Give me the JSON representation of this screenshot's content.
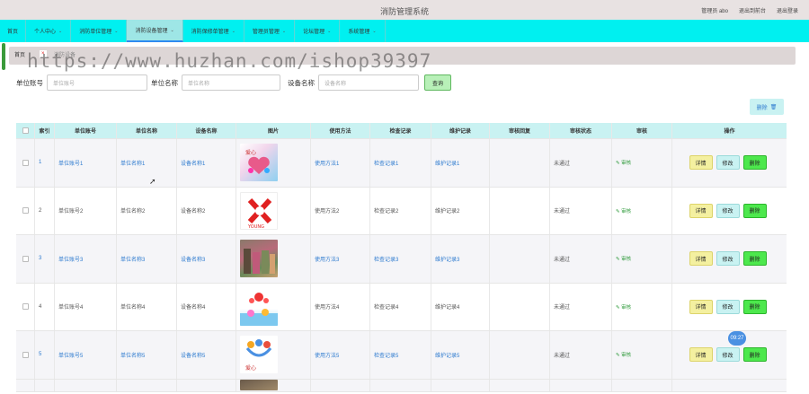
{
  "app": {
    "title": "消防管理系统",
    "admin_label": "管理员 abo",
    "exit_backend": "退出到前台",
    "logout": "退出登录"
  },
  "nav": {
    "items": [
      {
        "label": "首页",
        "caret": false,
        "active": false
      },
      {
        "label": "个人中心",
        "caret": true,
        "active": false
      },
      {
        "label": "消防单位管理",
        "caret": true,
        "active": false
      },
      {
        "label": "消防设备管理",
        "caret": true,
        "active": true
      },
      {
        "label": "消防保修单管理",
        "caret": true,
        "active": false
      },
      {
        "label": "管理员管理",
        "caret": true,
        "active": false
      },
      {
        "label": "论坛管理",
        "caret": true,
        "active": false
      },
      {
        "label": "系统管理",
        "caret": true,
        "active": false
      }
    ]
  },
  "tags": {
    "home": "首页",
    "current": "消防设备",
    "current_tag": "×"
  },
  "watermark": "https://www.huzhan.com/ishop39397",
  "search": {
    "unit_account_label": "单位账号",
    "unit_account_placeholder": "单位账号",
    "unit_name_label": "单位名称",
    "unit_name_placeholder": "单位名称",
    "device_name_label": "设备名称",
    "device_name_placeholder": "设备名称",
    "query_button": "查询"
  },
  "toolbar": {
    "delete_button": "删除"
  },
  "table": {
    "headers": [
      "索引",
      "单位账号",
      "单位名称",
      "设备名称",
      "图片",
      "使用方法",
      "检查记录",
      "维护记录",
      "审核回复",
      "审核状态",
      "审核",
      "操作"
    ],
    "rows": [
      {
        "index": "1",
        "account": "单位账号1",
        "unit": "单位名称1",
        "device": "设备名称1",
        "image": "img1",
        "usage": "使用方法1",
        "check": "检查记录1",
        "maint": "维护记录1",
        "reply": "",
        "status": "未通过",
        "audit": "审核"
      },
      {
        "index": "2",
        "account": "单位账号2",
        "unit": "单位名称2",
        "device": "设备名称2",
        "image": "img2",
        "usage": "使用方法2",
        "check": "检查记录2",
        "maint": "维护记录2",
        "reply": "",
        "status": "未通过",
        "audit": "审核"
      },
      {
        "index": "3",
        "account": "单位账号3",
        "unit": "单位名称3",
        "device": "设备名称3",
        "image": "img3",
        "usage": "使用方法3",
        "check": "检查记录3",
        "maint": "维护记录3",
        "reply": "",
        "status": "未通过",
        "audit": "审核"
      },
      {
        "index": "4",
        "account": "单位账号4",
        "unit": "单位名称4",
        "device": "设备名称4",
        "image": "img4",
        "usage": "使用方法4",
        "check": "检查记录4",
        "maint": "维护记录4",
        "reply": "",
        "status": "未通过",
        "audit": "审核"
      },
      {
        "index": "5",
        "account": "单位账号5",
        "unit": "单位名称5",
        "device": "设备名称5",
        "image": "img5",
        "usage": "使用方法5",
        "check": "检查记录5",
        "maint": "维护记录5",
        "reply": "",
        "status": "未通过",
        "audit": "审核"
      }
    ],
    "actions": {
      "detail": "详情",
      "edit": "修改",
      "delete": "删除"
    }
  },
  "bubble": "09:27",
  "colors": {
    "nav_bg": "#00f0f0",
    "header_bg": "#c9f2f2",
    "link": "#2e7bcf",
    "delete_green": "#4de84d",
    "detail_yellow": "#f4f0a0"
  }
}
